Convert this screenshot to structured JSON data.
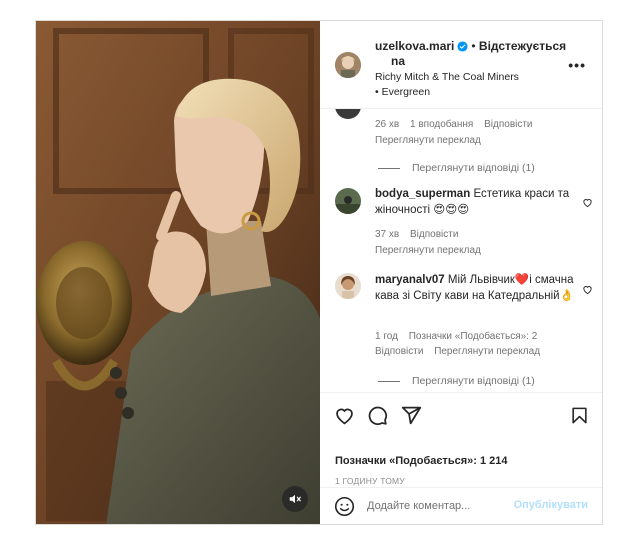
{
  "post": {
    "username": "uzelkova.mari",
    "username_tail": "na",
    "follow_label": "Відстежується",
    "separator": "•",
    "music": "Richy Mitch & The Coal Miners • Evergreen",
    "more": "•••"
  },
  "comments": [
    {
      "meta": {
        "time": "26 хв",
        "likes": "1 вподобання",
        "reply": "Відповісти",
        "translate": "Переглянути переклад"
      },
      "view_replies": "Переглянути відповіді (1)"
    },
    {
      "user": "bodya_superman",
      "text": "Естетика краси та жіночності 😍😍😍",
      "meta": {
        "time": "37 хв",
        "reply": "Відповісти",
        "translate": "Переглянути переклад"
      }
    },
    {
      "user": "maryanalv07",
      "text": "Мій Львівчик❤️і смачна кава зі Світу кави на Катедральній👌",
      "meta": {
        "time": "1 год",
        "likes": "Позначки «Подобається»: 2",
        "reply": "Відповісти",
        "translate": "Переглянути переклад"
      },
      "view_replies": "Переглянути відповіді (1)"
    }
  ],
  "likes_text": "Позначки «Подобається»: 1 214",
  "post_time": "1 ГОДИНУ ТОМУ",
  "composer": {
    "placeholder": "Додайте коментар...",
    "publish": "Опублікувати"
  },
  "icons": {
    "verified": "verified-badge-icon",
    "like": "heart-icon",
    "comment": "comment-icon",
    "share": "paper-plane-icon",
    "save": "bookmark-icon",
    "emoji": "smiley-icon",
    "mute": "speaker-muted-icon"
  },
  "colors": {
    "verified": "#0095f6",
    "publish_disabled": "#b2dffc",
    "muted_text": "#737373"
  }
}
